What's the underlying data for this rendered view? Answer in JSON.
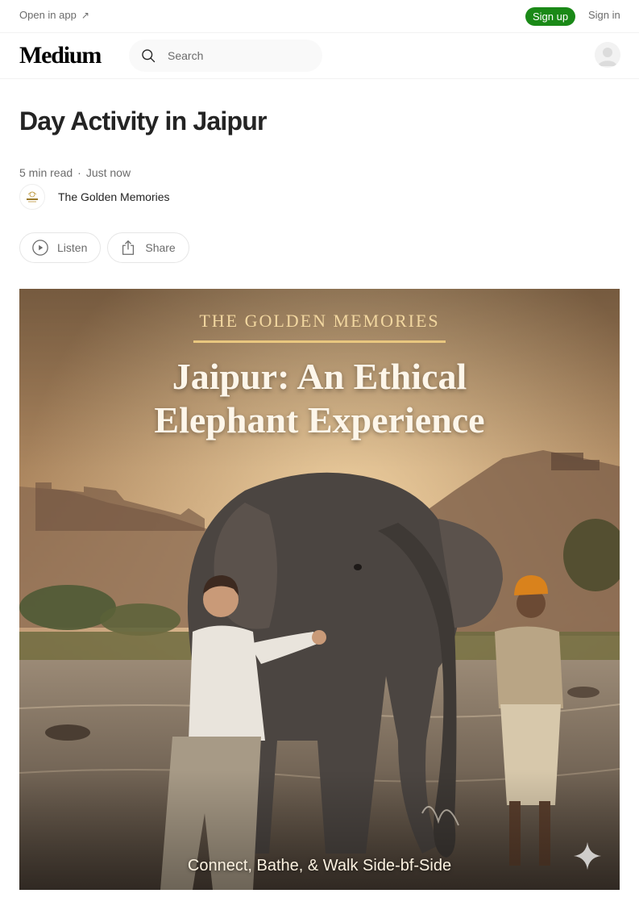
{
  "topbar": {
    "open_in_app": "Open in app",
    "open_in_app_icon": "arrow-up-right-icon",
    "sign_up": "Sign up",
    "sign_in": "Sign in"
  },
  "nav": {
    "logo": "Medium",
    "search_placeholder": "Search",
    "search_icon": "search-icon",
    "avatar_icon": "user-avatar-icon"
  },
  "article": {
    "title": "Day Activity in Jaipur",
    "read_time": "5 min read",
    "separator": "·",
    "published": "Just now",
    "author": "The Golden Memories",
    "actions": {
      "listen": "Listen",
      "share": "Share"
    }
  },
  "hero": {
    "brand": "THE GOLDEN MEMORIES",
    "title_line1": "Jaipur: An Ethical",
    "title_line2": "Elephant Experience",
    "caption": "Connect, Bathe, & Walk Side-bf-Side"
  },
  "colors": {
    "accent_green": "#1a8917",
    "text_primary": "#242424",
    "text_secondary": "#6b6b6b"
  }
}
